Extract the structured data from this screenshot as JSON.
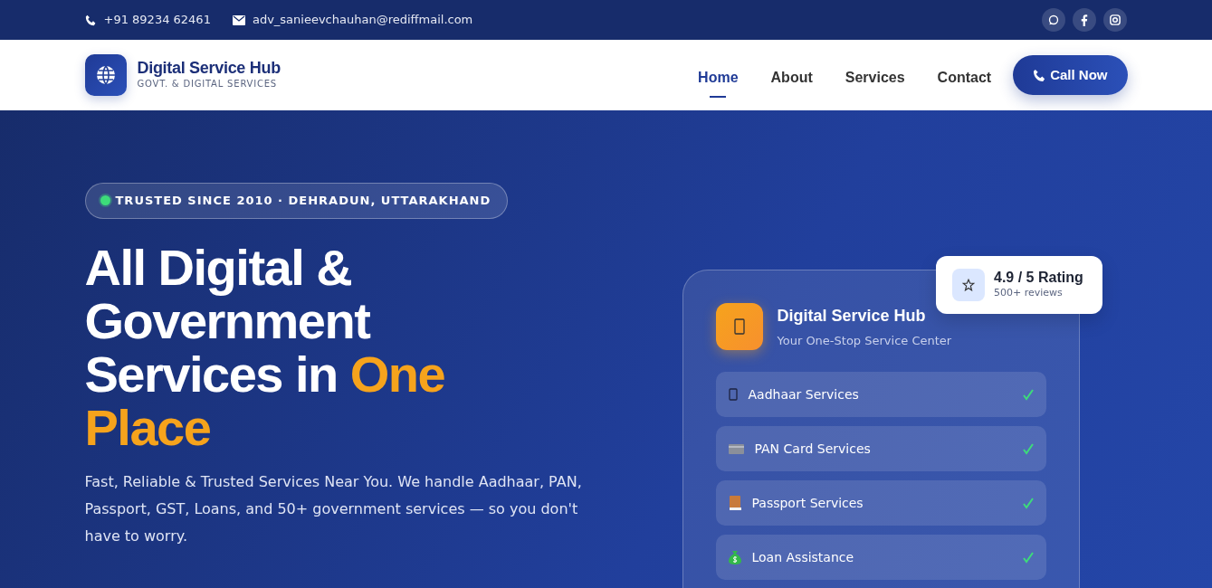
{
  "topbar": {
    "phone": "+91 89234 62461",
    "email": "adv_sanieevchauhan@rediffmail.com"
  },
  "brand": {
    "name": "Digital Service Hub",
    "tagline": "GOVT. & DIGITAL SERVICES"
  },
  "nav": [
    {
      "label": "Home",
      "selected": true
    },
    {
      "label": "About",
      "selected": false
    },
    {
      "label": "Services",
      "selected": false
    },
    {
      "label": "Contact",
      "selected": false
    }
  ],
  "call_button": "Call Now",
  "hero": {
    "badge": "TRUSTED SINCE 2010 · DEHRADUN, UTTARAKHAND",
    "title": "All Digital & Government Services in **One Place**",
    "description": "Fast, Reliable & Trusted Services Near You. We handle Aadhaar, PAN, Passport, GST, Loans, and 50+ government services — so you don't have to worry."
  },
  "card": {
    "title": "Digital Service Hub",
    "subtitle": "Your One-Stop Service Center",
    "services": [
      {
        "label": "Aadhaar Services"
      },
      {
        "label": "PAN Card Services"
      },
      {
        "label": "Passport Services"
      },
      {
        "label": "Loan Assistance"
      }
    ]
  },
  "rating": {
    "title": "4.9 / 5 Rating",
    "subtitle": "500+ reviews"
  }
}
